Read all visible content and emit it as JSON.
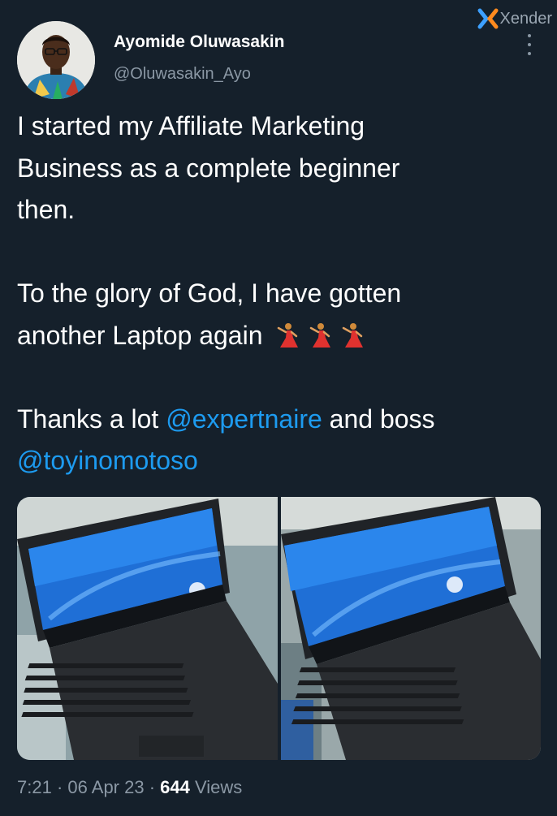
{
  "watermark": {
    "label": "Xender",
    "icon": "xender-x-logo"
  },
  "author": {
    "display_name": "Ayomide Oluwasakin",
    "handle": "@Oluwasakin_Ayo"
  },
  "tweet": {
    "lines": [
      "I started my Affiliate Marketing",
      "Business as a complete beginner",
      "then.",
      "To the glory of God, I have gotten",
      "another Laptop again"
    ],
    "emoji": [
      "woman-dancing",
      "woman-dancing",
      "woman-dancing"
    ],
    "thanks_text": "Thanks a lot",
    "mention_1": "@expertnaire",
    "and_boss": "and boss",
    "mention_2": "@toyinomotoso"
  },
  "media": [
    {
      "alt": "hp laptop photo 1"
    },
    {
      "alt": "hp laptop photo 2"
    }
  ],
  "meta": {
    "time": "7:21",
    "sep1": "·",
    "date": "06 Apr 23",
    "sep2": "·",
    "views_count": "644",
    "views_label": "Views"
  },
  "colors": {
    "background": "#15202b",
    "text": "#ffffff",
    "secondary": "#8b98a5",
    "link": "#1d9bf0"
  }
}
